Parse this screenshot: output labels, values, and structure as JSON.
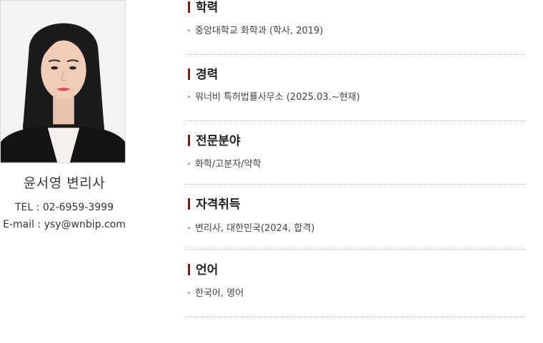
{
  "profile": {
    "name": "윤서영 변리사",
    "tel": "TEL : 02-6959-3999",
    "email": "E-mail : ysy@wnbip.com"
  },
  "sections": [
    {
      "title": "학력",
      "items": [
        "중앙대학교 화학과 (학사, 2019)"
      ]
    },
    {
      "title": "경력",
      "items": [
        "워너비 특허법률사무소 (2025.03.~현재)"
      ]
    },
    {
      "title": "전문분야",
      "items": [
        "화학/고분자/약학"
      ]
    },
    {
      "title": "자격취득",
      "items": [
        "변리사, 대한민국(2024, 합격)"
      ]
    },
    {
      "title": "언어",
      "items": [
        "한국어, 영어"
      ]
    }
  ],
  "colors": {
    "accent_bar": "#7a1f1f",
    "bullet": "#b0b0b0",
    "divider": "#bdbdbd"
  }
}
